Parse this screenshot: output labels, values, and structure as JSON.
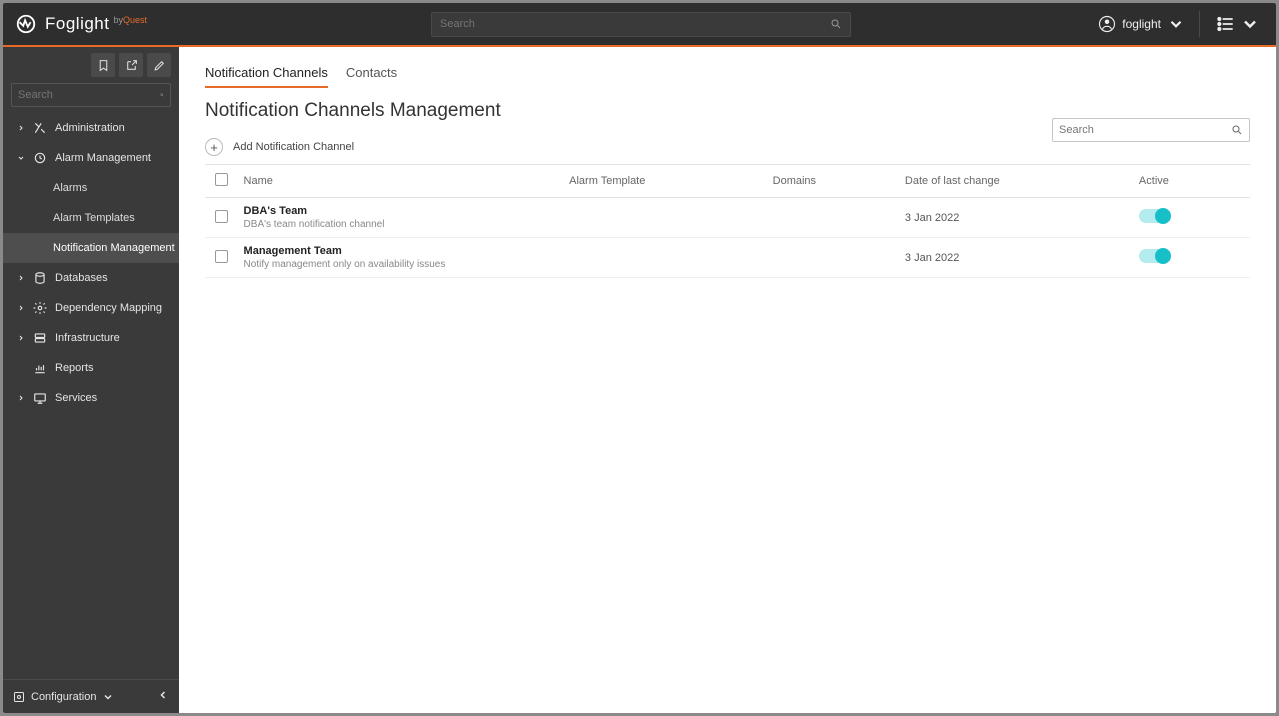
{
  "header": {
    "product": "Foglight",
    "by": "by",
    "quest": "Quest",
    "search_placeholder": "Search",
    "username": "foglight"
  },
  "sidebar": {
    "search_placeholder": "Search",
    "footer_label": "Configuration",
    "items": [
      {
        "label": "Administration",
        "expanded": false
      },
      {
        "label": "Alarm Management",
        "expanded": true,
        "children": [
          {
            "label": "Alarms",
            "active": false
          },
          {
            "label": "Alarm Templates",
            "active": false
          },
          {
            "label": "Notification Management",
            "active": true
          }
        ]
      },
      {
        "label": "Databases",
        "expanded": false
      },
      {
        "label": "Dependency Mapping",
        "expanded": false
      },
      {
        "label": "Infrastructure",
        "expanded": false
      },
      {
        "label": "Reports",
        "expanded": false,
        "no_chev": true
      },
      {
        "label": "Services",
        "expanded": false
      }
    ]
  },
  "main": {
    "tabs": [
      {
        "label": "Notification Channels",
        "active": true
      },
      {
        "label": "Contacts",
        "active": false
      }
    ],
    "title": "Notification Channels Management",
    "add_label": "Add Notification Channel",
    "table_search_placeholder": "Search",
    "columns": {
      "name": "Name",
      "template": "Alarm Template",
      "domains": "Domains",
      "date": "Date of last change",
      "active": "Active"
    },
    "rows": [
      {
        "name": "DBA's Team",
        "desc": "DBA's team notification channel",
        "template": "",
        "domains": "",
        "date": "3 Jan 2022",
        "active": true
      },
      {
        "name": "Management Team",
        "desc": "Notify management only on availability issues",
        "template": "",
        "domains": "",
        "date": "3 Jan 2022",
        "active": true
      }
    ]
  }
}
